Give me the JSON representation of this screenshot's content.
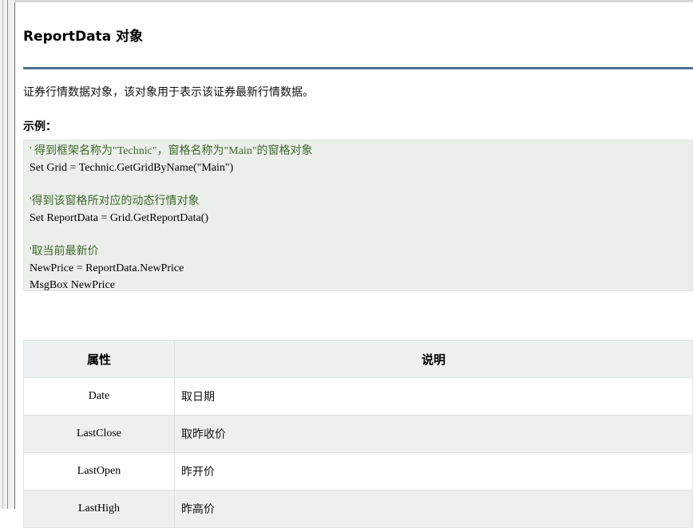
{
  "page": {
    "title": "ReportData 对象",
    "description": "证券行情数据对象，该对象用于表示该证券最新行情数据。",
    "example_label": "示例："
  },
  "code_lines": [
    {
      "kind": "comment",
      "text": "' 得到框架名称为\"Technic\"，窗格名称为\"Main\"的窗格对象"
    },
    {
      "kind": "stmt",
      "text": "Set Grid = Technic.GetGridByName(\"Main\")"
    },
    {
      "kind": "blank",
      "text": ""
    },
    {
      "kind": "comment",
      "text": "'得到该窗格所对应的动态行情对象"
    },
    {
      "kind": "stmt",
      "text": "Set ReportData = Grid.GetReportData()"
    },
    {
      "kind": "blank",
      "text": ""
    },
    {
      "kind": "comment",
      "text": "'取当前最新价"
    },
    {
      "kind": "stmt",
      "text": "NewPrice = ReportData.NewPrice"
    },
    {
      "kind": "stmt",
      "text": "MsgBox NewPrice"
    }
  ],
  "table": {
    "headers": [
      "属性",
      "说明"
    ],
    "rows": [
      {
        "name": "Date",
        "desc": "取日期"
      },
      {
        "name": "LastClose",
        "desc": "取昨收价"
      },
      {
        "name": "LastOpen",
        "desc": "昨开价"
      },
      {
        "name": "LastHigh",
        "desc": "昨高价"
      }
    ]
  },
  "colors": {
    "title_rule": "#4f6f93",
    "code_bg": "#ebeeeb",
    "comment": "#3d6a2a",
    "table_header_bg": "#edf1f1"
  }
}
